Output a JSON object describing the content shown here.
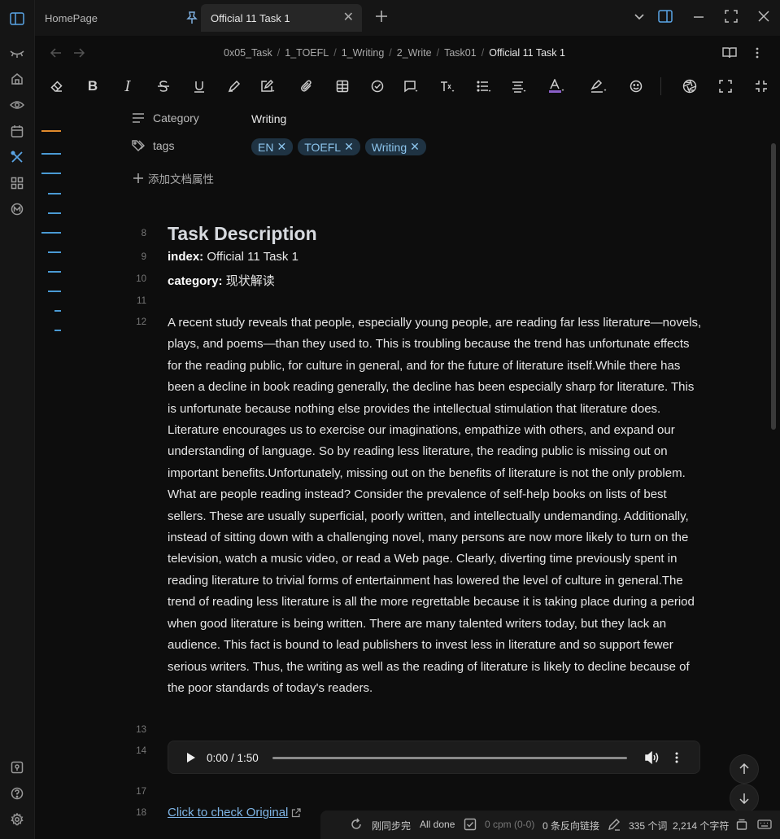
{
  "tabs": {
    "inactive_label": "HomePage",
    "active_label": "Official 11 Task 1"
  },
  "breadcrumb": [
    "0x05_Task",
    "1_TOEFL",
    "1_Writing",
    "2_Write",
    "Task01",
    "Official 11 Task 1"
  ],
  "properties": {
    "category_key": "Category",
    "category_value": "Writing",
    "tags_key": "tags",
    "tags": [
      "EN",
      "TOEFL",
      "Writing"
    ],
    "add_property": "添加文档属性"
  },
  "line_numbers": {
    "heading": "8",
    "index": "9",
    "category": "10",
    "blank1": "11",
    "para": "12",
    "blank2": "13",
    "audio": "14",
    "blank3": "17",
    "link": "18"
  },
  "document": {
    "heading": "Task Description",
    "index_label": "index:",
    "index_value": "Official 11 Task 1",
    "category_label": "category:",
    "category_value": "现状解读",
    "paragraph": "A recent study reveals that people, especially young people, are reading far less literature—novels, plays, and poems—than they used to. This is troubling because the trend has unfortunate effects for the reading public, for culture in general, and for the future of literature itself.While there has been a decline in book reading generally, the decline has been especially sharp for literature. This is unfortunate because nothing else provides the intellectual stimulation that literature does. Literature encourages us to exercise our imaginations, empathize with others, and expand our understanding of language. So by reading less literature, the reading public is missing out on important benefits.Unfortunately, missing out on the benefits of literature is not the only problem. What are people reading instead? Consider the prevalence of self-help books on lists of best sellers. These are usually superficial, poorly written, and intellectually undemanding. Additionally, instead of sitting down with a challenging novel, many persons are now more likely to turn on the television, watch a music video, or read a Web page. Clearly, diverting time previously spent in reading literature to trivial forms of entertainment has lowered the level of culture in general.The trend of reading less literature is all the more regrettable because it is taking place during a period when good literature is being written. There are many talented writers today, but they lack an audience. This fact is bound to lead publishers to invest less in literature and so support fewer serious writers. Thus, the writing as well as the reading of literature is likely to decline because of the poor standards of today's readers.",
    "link_text": "Click to check Original"
  },
  "audio": {
    "time": "0:00 / 1:50",
    "progress": 0
  },
  "status": {
    "sync": "刚同步完",
    "done": "All done",
    "cpm": "0 cpm (0-0)",
    "backlinks": "0 条反向链接",
    "words": "335 个词",
    "chars": "2,214 个字符"
  },
  "colors": {
    "accent": "#4a9ad4",
    "tag_bg": "#1f3343",
    "tag_text": "#8cc4ec",
    "link": "#7fb5e6",
    "outline_active": "#e08a2c"
  }
}
